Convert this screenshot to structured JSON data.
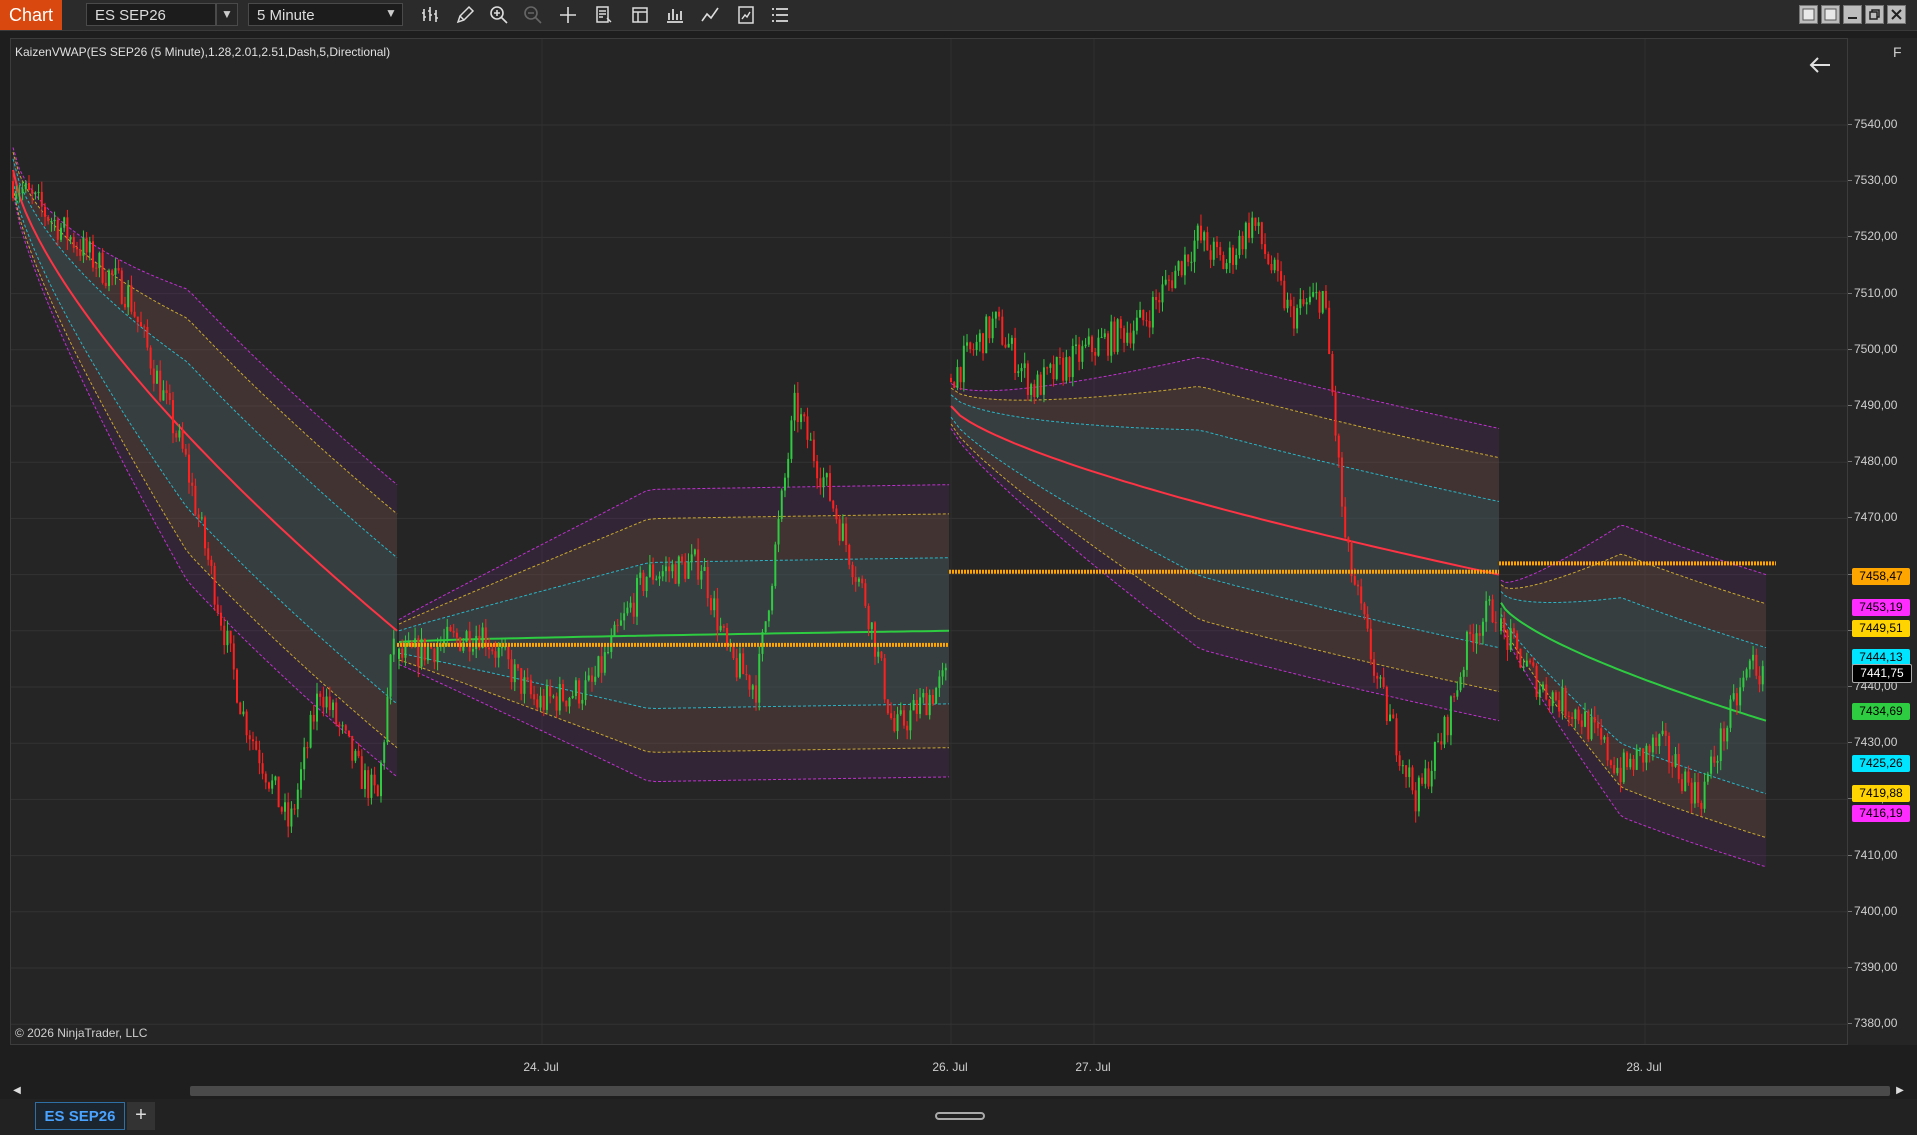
{
  "toolbar": {
    "chart_tab": "Chart",
    "instrument": "ES SEP26",
    "interval": "5 Minute",
    "tools": [
      "bars-type-icon",
      "drawing-pencil-icon",
      "zoom-in-icon",
      "zoom-out-icon",
      "crosshair-icon",
      "data-box-icon",
      "properties-icon",
      "strategies-icon",
      "indicators-icon",
      "chart-trader-icon",
      "menu-icon"
    ]
  },
  "chart": {
    "indicator_label": "KaizenVWAP(ES SEP26 (5 Minute),1.28,2.01,2.51,Dash,5,Directional)",
    "copyright": "© 2026 NinjaTrader, LLC",
    "f_label": "F",
    "price_ticks": [
      "7540,00",
      "7530,00",
      "7520,00",
      "7510,00",
      "7500,00",
      "7490,00",
      "7480,00",
      "7470,00",
      "7460,00",
      "7450,00",
      "7440,00",
      "7430,00",
      "7420,00",
      "7410,00",
      "7400,00",
      "7390,00",
      "7380,00"
    ],
    "price_labels": [
      {
        "text": "7458,47",
        "price": 7458.47,
        "color": "#ffa500"
      },
      {
        "text": "7453,19",
        "price": 7453.19,
        "color": "#ff2cff"
      },
      {
        "text": "7449,51",
        "price": 7449.51,
        "color": "#ffd400"
      },
      {
        "text": "7444,13",
        "price": 7444.13,
        "color": "#00e5ff"
      },
      {
        "text": "7441,75",
        "price": 7441.75,
        "color": "#000000"
      },
      {
        "text": "7434,69",
        "price": 7434.69,
        "color": "#2ecc40"
      },
      {
        "text": "7425,26",
        "price": 7425.26,
        "color": "#00e5ff"
      },
      {
        "text": "7419,88",
        "price": 7419.88,
        "color": "#ffd400"
      },
      {
        "text": "7416,19",
        "price": 7416.19,
        "color": "#ff2cff"
      }
    ],
    "time_labels": [
      "24. Jul",
      "26. Jul",
      "27. Jul",
      "28. Jul"
    ],
    "colors": {
      "up": "#2ecc40",
      "down": "#ff2020",
      "vwap_red": "#ff3344",
      "vwap_green": "#2ecc40",
      "band1": "#27b6c8",
      "band2": "#c8a830",
      "band3": "#c030d0",
      "level": "#ffa500"
    }
  },
  "bottom": {
    "instrument_tab": "ES SEP26",
    "add_tab": "+"
  }
}
